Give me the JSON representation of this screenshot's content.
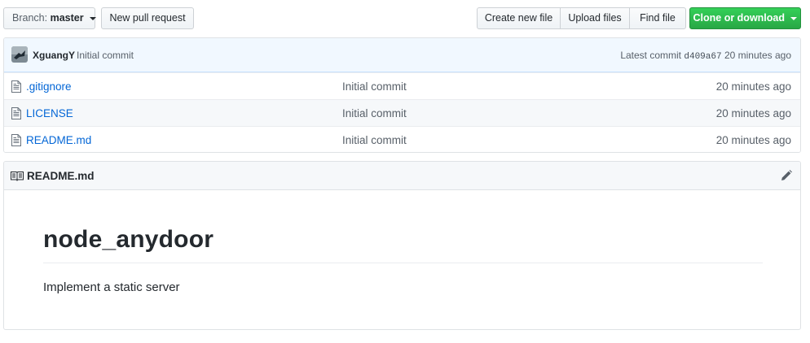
{
  "toolbar": {
    "branch_prefix": "Branch:",
    "branch_name": "master",
    "new_pull_request": "New pull request",
    "create_new_file": "Create new file",
    "upload_files": "Upload files",
    "find_file": "Find file",
    "clone_or_download": "Clone or download"
  },
  "commit": {
    "author": "XguangY",
    "message": "Initial commit",
    "latest_label": "Latest commit",
    "sha": "d409a67",
    "age": "20 minutes ago"
  },
  "files": [
    {
      "name": ".gitignore",
      "message": "Initial commit",
      "age": "20 minutes ago"
    },
    {
      "name": "LICENSE",
      "message": "Initial commit",
      "age": "20 minutes ago"
    },
    {
      "name": "README.md",
      "message": "Initial commit",
      "age": "20 minutes ago"
    }
  ],
  "readme": {
    "header": "README.md",
    "heading": "node_anydoor",
    "description": "Implement a static server"
  },
  "colors": {
    "link": "#0366d6",
    "primary_green": "#28a745",
    "commit_tease_bg": "#f1f8ff"
  },
  "icons": {
    "file": "file-icon",
    "book": "book-icon",
    "pencil": "pencil-icon",
    "caret": "triangle-down-icon"
  }
}
